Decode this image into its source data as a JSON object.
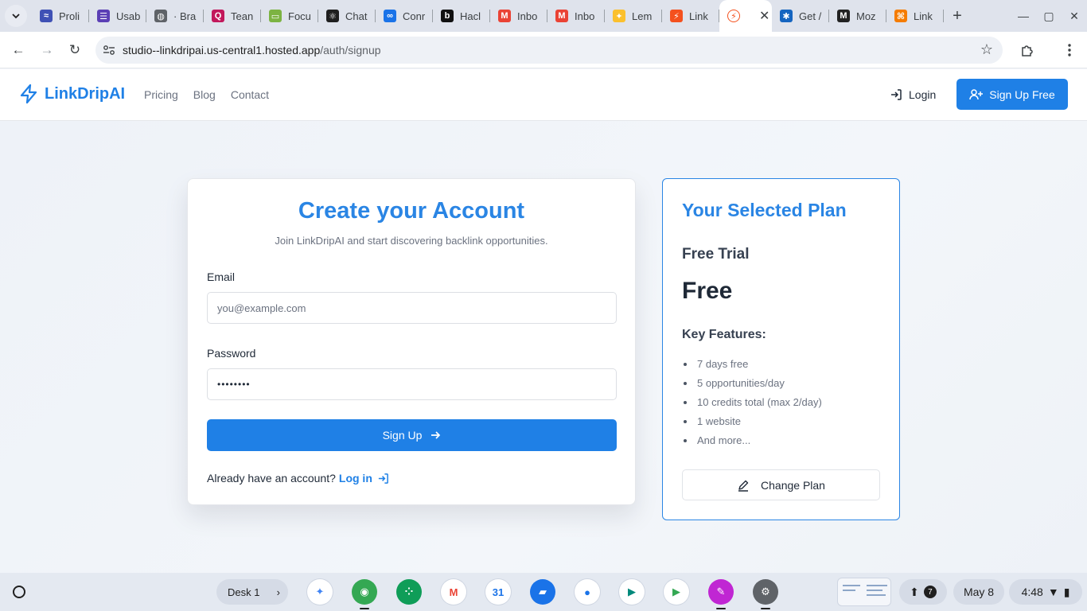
{
  "browser": {
    "tabs": [
      {
        "title": "Proli",
        "color": "#3f51b5",
        "glyph": "≈"
      },
      {
        "title": "Usab",
        "color": "#5b3fb5",
        "glyph": "☰"
      },
      {
        "title": "· Bra",
        "color": "#5f6368",
        "glyph": "◍"
      },
      {
        "title": "Tean",
        "color": "#c2185b",
        "glyph": "Q"
      },
      {
        "title": "Focu",
        "color": "#7cb342",
        "glyph": "▭"
      },
      {
        "title": "Chat",
        "color": "#1f1f1f",
        "glyph": "⚛"
      },
      {
        "title": "Conr",
        "color": "#1a73e8",
        "glyph": "∞"
      },
      {
        "title": "Hacl",
        "color": "#111111",
        "glyph": "b"
      },
      {
        "title": "Inbo",
        "color": "#ea4335",
        "glyph": "M"
      },
      {
        "title": "Inbo",
        "color": "#ea4335",
        "glyph": "M"
      },
      {
        "title": "Lem",
        "color": "#fbc02d",
        "glyph": "✦"
      },
      {
        "title": "Link",
        "color": "#f4511e",
        "glyph": "⚡"
      }
    ],
    "active_tab": {
      "color": "#f4511e",
      "glyph": "⚡"
    },
    "tabs_after": [
      {
        "title": "Get /",
        "color": "#1565c0",
        "glyph": "✱"
      },
      {
        "title": "Moz",
        "color": "#222222",
        "glyph": "M"
      },
      {
        "title": "Link",
        "color": "#f57c00",
        "glyph": "⌘"
      }
    ],
    "url_host": "studio--linkdripai.us-central1.hosted.app",
    "url_path": "/auth/signup"
  },
  "site": {
    "brand": "LinkDripAI",
    "nav": [
      "Pricing",
      "Blog",
      "Contact"
    ],
    "login": "Login",
    "signup_free": "Sign Up Free"
  },
  "signup": {
    "title": "Create your Account",
    "subtitle": "Join LinkDripAI and start discovering backlink opportunities.",
    "email_label": "Email",
    "email_placeholder": "you@example.com",
    "password_label": "Password",
    "password_value": "••••••••",
    "submit": "Sign Up",
    "already": "Already have an account?",
    "login_link": "Log in"
  },
  "plan": {
    "heading": "Your Selected Plan",
    "name": "Free Trial",
    "price": "Free",
    "features_heading": "Key Features:",
    "features": [
      "7 days free",
      "5 opportunities/day",
      "10 credits total (max 2/day)",
      "1 website",
      "And more..."
    ],
    "change": "Change Plan"
  },
  "shelf": {
    "desk": "Desk 1",
    "notifications": "7",
    "date": "May 8",
    "time": "4:48",
    "apps": [
      {
        "name": "gemini",
        "color": "#ffffff",
        "glyph": "✦",
        "fg": "#4285f4"
      },
      {
        "name": "chrome",
        "color": "#34a853",
        "glyph": "◉",
        "fg": "#ffffff",
        "running": true
      },
      {
        "name": "slack-like",
        "color": "#0f9d58",
        "glyph": "⁘",
        "fg": "#ffffff"
      },
      {
        "name": "gmail",
        "color": "#ffffff",
        "glyph": "M",
        "fg": "#ea4335"
      },
      {
        "name": "calendar",
        "color": "#ffffff",
        "glyph": "31",
        "fg": "#1a73e8"
      },
      {
        "name": "files",
        "color": "#1a73e8",
        "glyph": "▰",
        "fg": "#ffffff"
      },
      {
        "name": "messages",
        "color": "#ffffff",
        "glyph": "●",
        "fg": "#1a73e8"
      },
      {
        "name": "meet",
        "color": "#ffffff",
        "glyph": "▶",
        "fg": "#00897b"
      },
      {
        "name": "play-store",
        "color": "#ffffff",
        "glyph": "▶",
        "fg": "#34a853"
      },
      {
        "name": "screenshot-app",
        "color": "#c026d3",
        "glyph": "✎",
        "fg": "#ffffff",
        "running": true
      },
      {
        "name": "settings",
        "color": "#5f6368",
        "glyph": "⚙",
        "fg": "#ffffff",
        "running": true
      }
    ]
  }
}
